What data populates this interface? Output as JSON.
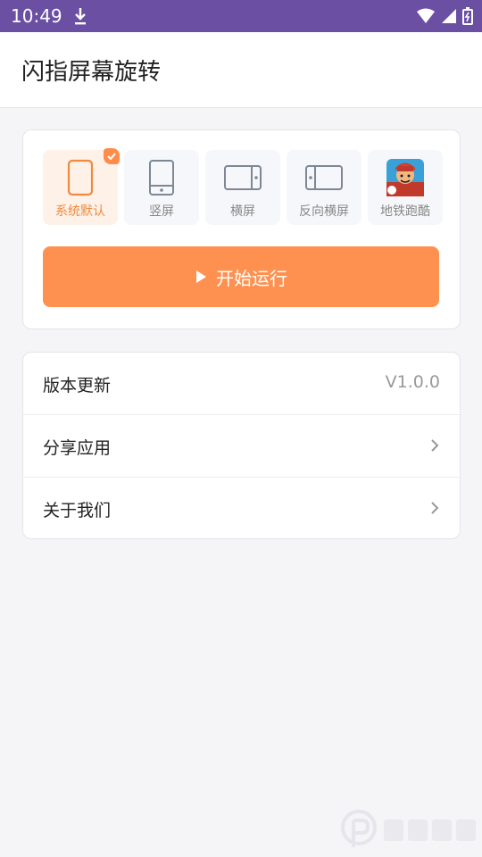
{
  "status_bar": {
    "time": "10:49"
  },
  "app": {
    "title": "闪指屏幕旋转"
  },
  "modes": [
    {
      "label": "系统默认",
      "icon": "phone-outline-icon",
      "selected": true
    },
    {
      "label": "竖屏",
      "icon": "portrait-phone-icon",
      "selected": false
    },
    {
      "label": "横屏",
      "icon": "landscape-phone-icon",
      "selected": false
    },
    {
      "label": "反向横屏",
      "icon": "reverse-landscape-phone-icon",
      "selected": false
    },
    {
      "label": "地铁跑酷",
      "icon": "subway-surfers-app-icon",
      "selected": false
    }
  ],
  "run_button": {
    "label": "开始运行"
  },
  "menu": [
    {
      "label": "版本更新",
      "value": "V1.0.0"
    },
    {
      "label": "分享应用"
    },
    {
      "label": "关于我们"
    }
  ],
  "colors": {
    "accent": "#ff9150",
    "status_bar": "#6b4fa3",
    "active_tile": "#fdf1e8"
  }
}
